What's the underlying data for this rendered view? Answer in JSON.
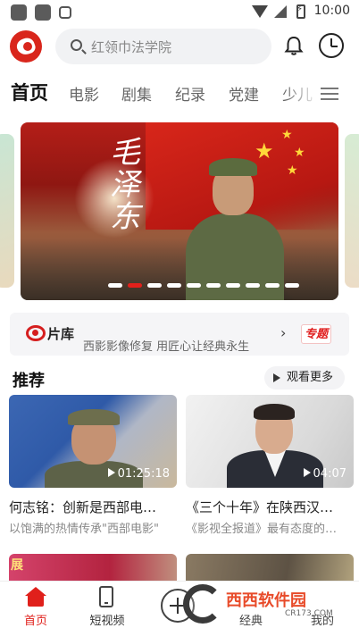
{
  "status_bar": {
    "time": "10:00"
  },
  "header": {
    "logo": "app-logo",
    "search_placeholder": "红领巾法学院",
    "icons": [
      "bell-icon",
      "clock-icon"
    ]
  },
  "tabs": {
    "items": [
      "首页",
      "电影",
      "剧集",
      "纪录",
      "党建",
      "少儿"
    ],
    "active": "首页"
  },
  "banner": {
    "slide_count": 10,
    "active_index": 1,
    "calligraphy": "毛泽东"
  },
  "library": {
    "title": "片库",
    "subtitle": "西影影像修复 用匠心让经典永生",
    "badge": "专题"
  },
  "recommend": {
    "title": "推荐",
    "more_label": "观看更多",
    "cards": [
      {
        "duration": "01:25:18",
        "title": "何志铭：创新是西部电…",
        "subtitle": "以饱满的热情传承\"西部电影\""
      },
      {
        "duration": "04:07",
        "title": "《三个十年》在陕西汉…",
        "subtitle": "《影视全报道》最有态度的…"
      }
    ],
    "peek_text": "展"
  },
  "bottom_nav": {
    "items": [
      {
        "label": "首页",
        "icon": "home-icon",
        "active": true
      },
      {
        "label": "短视频",
        "icon": "phone-icon",
        "active": false
      },
      {
        "label": "",
        "icon": "add-icon",
        "active": false
      },
      {
        "label": "经典",
        "icon": "classic-icon",
        "active": false
      },
      {
        "label": "我的",
        "icon": "profile-icon",
        "active": false
      }
    ]
  },
  "watermark": {
    "text": "西西软件园",
    "url": "CR173.COM"
  },
  "colors": {
    "accent": "#e0201b",
    "search_bg": "#f1f2f4"
  }
}
